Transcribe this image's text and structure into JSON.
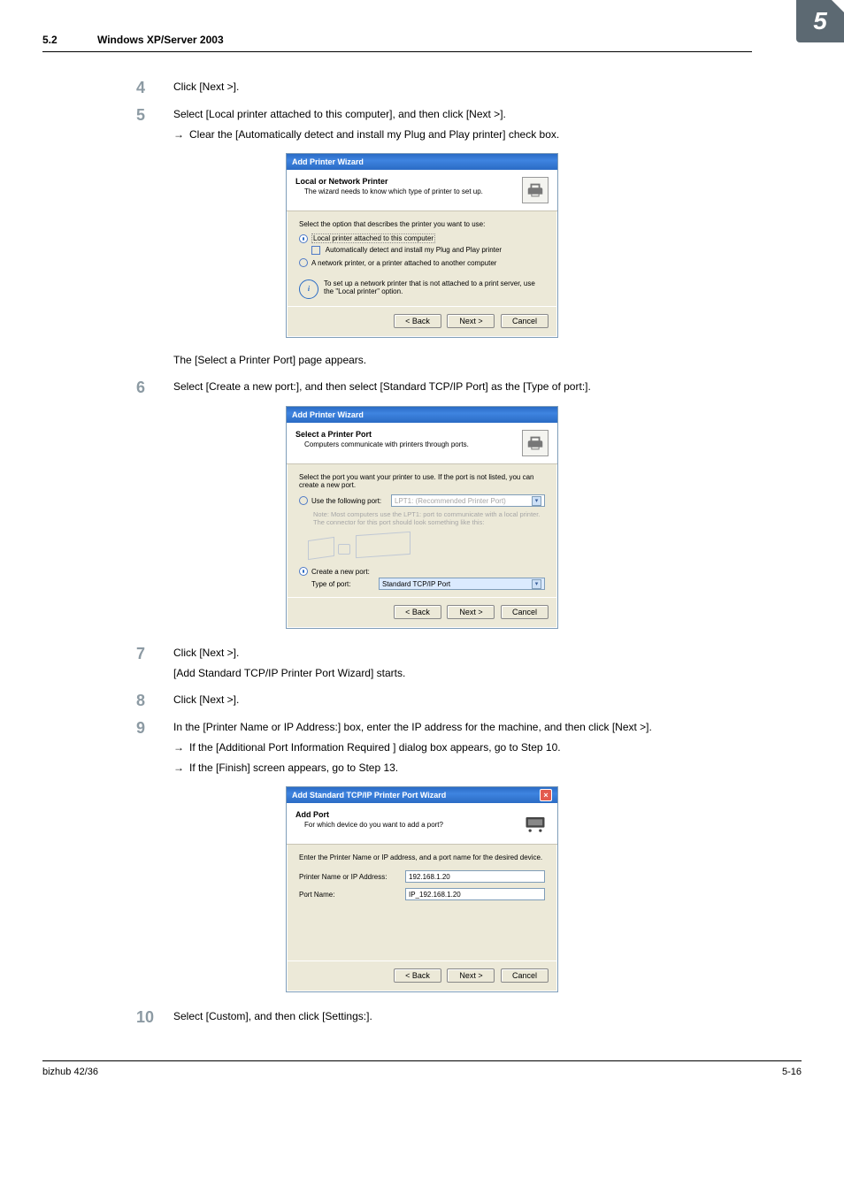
{
  "chapter_badge": "5",
  "header": {
    "section_num": "5.2",
    "section_title": "Windows XP/Server 2003"
  },
  "steps": {
    "s4": {
      "num": "4",
      "text": "Click [Next >]."
    },
    "s5": {
      "num": "5",
      "text": "Select [Local printer attached to this computer], and then click [Next >].",
      "bullet1": "Clear the [Automatically detect and install my Plug and Play printer] check box."
    },
    "after5": "The [Select a Printer Port] page appears.",
    "s6": {
      "num": "6",
      "text": "Select [Create a new port:], and then select [Standard TCP/IP Port] as the [Type of port:]."
    },
    "s7": {
      "num": "7",
      "text": "Click [Next >].",
      "line2": "[Add Standard TCP/IP Printer Port Wizard] starts."
    },
    "s8": {
      "num": "8",
      "text": "Click [Next >]."
    },
    "s9": {
      "num": "9",
      "text": "In the [Printer Name or IP Address:] box, enter the IP address for the machine, and then click [Next >].",
      "b1": "If the [Additional Port Information Required ] dialog box appears, go to Step 10.",
      "b2": "If the [Finish] screen appears, go to Step 13."
    },
    "s10": {
      "num": "10",
      "text": "Select [Custom], and then click [Settings:]."
    }
  },
  "dlg1": {
    "title": "Add Printer Wizard",
    "head1": "Local or Network Printer",
    "head2": "The wizard needs to know which type of printer to set up.",
    "line1": "Select the option that describes the printer you want to use:",
    "opt1": "Local printer attached to this computer",
    "chk1": "Automatically detect and install my Plug and Play printer",
    "opt2": "A network printer, or a printer attached to another computer",
    "info": "To set up a network printer that is not attached to a print server, use the \"Local printer\" option.",
    "back": "< Back",
    "next": "Next >",
    "cancel": "Cancel"
  },
  "dlg2": {
    "title": "Add Printer Wizard",
    "head1": "Select a Printer Port",
    "head2": "Computers communicate with printers through ports.",
    "line1": "Select the port you want your printer to use. If the port is not listed, you can create a new port.",
    "opt1": "Use the following port:",
    "opt1val": "LPT1: (Recommended Printer Port)",
    "note": "Note: Most computers use the LPT1: port to communicate with a local printer. The connector for this port should look something like this:",
    "opt2": "Create a new port:",
    "typelbl": "Type of port:",
    "typeval": "Standard TCP/IP Port",
    "back": "< Back",
    "next": "Next >",
    "cancel": "Cancel"
  },
  "dlg3": {
    "title": "Add Standard TCP/IP Printer Port Wizard",
    "head1": "Add Port",
    "head2": "For which device do you want to add a port?",
    "line1": "Enter the Printer Name or IP address, and a port name for the desired device.",
    "lbl1": "Printer Name or IP Address:",
    "val1": "192.168.1.20",
    "lbl2": "Port Name:",
    "val2": "IP_192.168.1.20",
    "back": "< Back",
    "next": "Next >",
    "cancel": "Cancel"
  },
  "footer": {
    "left": "bizhub 42/36",
    "right": "5-16"
  }
}
